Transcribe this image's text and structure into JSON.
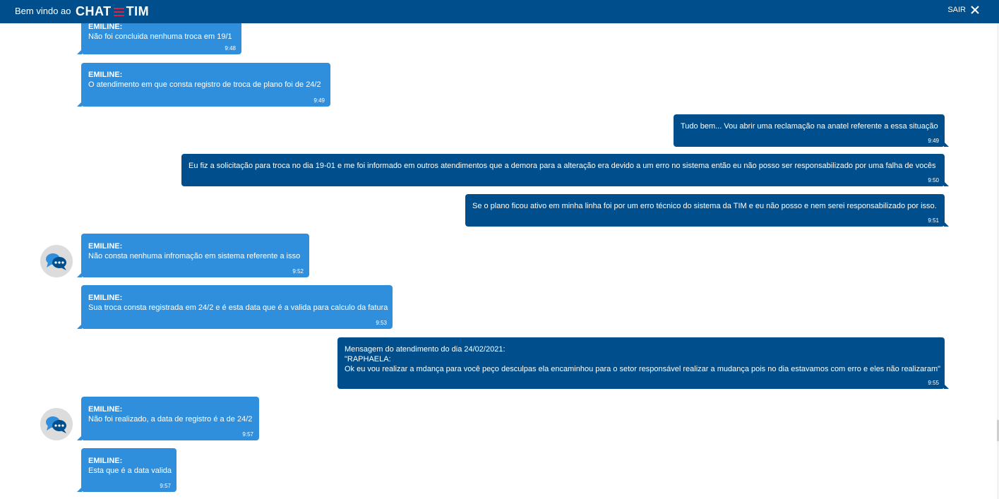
{
  "header": {
    "welcome": "Bem vindo ao",
    "brand_left": "CHAT",
    "brand_right": "TIM",
    "logout_label": "SAIR"
  },
  "messages": [
    {
      "sender": "EMILINE:",
      "text": "Não foi concluida nenhuma troca em 19/1",
      "time": "9:48"
    },
    {
      "sender": "EMILINE:",
      "text": "O atendimento em que consta registro de troca de plano foi de 24/2",
      "time": "9:49"
    },
    {
      "text": "Tudo bem... Vou abrir uma reclamação na anatel referente a essa situação",
      "time": "9:49"
    },
    {
      "text": "Eu fiz a solicitação para troca no dia 19-01 e me foi informado em outros atendimentos que a demora para a alteração era devido a um erro no sistema então eu não posso ser responsabilizado por uma falha de vocês",
      "time": "9:50"
    },
    {
      "text": "Se o plano ficou ativo em minha linha foi por um erro técnico do sistema da TIM e eu não posso e nem serei responsabilizado por isso.",
      "time": "9:51"
    },
    {
      "sender": "EMILINE:",
      "text": "Não consta nenhuma infromação em sistema referente a isso",
      "time": "9:52"
    },
    {
      "sender": "EMILINE:",
      "text": "Sua troca consta registrada em 24/2 e é esta data que é a valida para calculo da fatura",
      "time": "9:53"
    },
    {
      "lines": [
        "Mensagem do atendimento do dia 24/02/2021:",
        "\"RAPHAELA:",
        "Ok eu vou realizar a mdança para você peço desculpas ela encaminhou para o setor responsável realizar a mudança pois no dia estavamos com erro e eles não realizaram\""
      ],
      "time": "9:55"
    },
    {
      "sender": "EMILINE:",
      "text": "Não foi realizado, a data de registro é a de 24/2",
      "time": "9:57"
    },
    {
      "sender": "EMILINE:",
      "text": "Esta que é a data valida",
      "time": "9:57"
    }
  ]
}
